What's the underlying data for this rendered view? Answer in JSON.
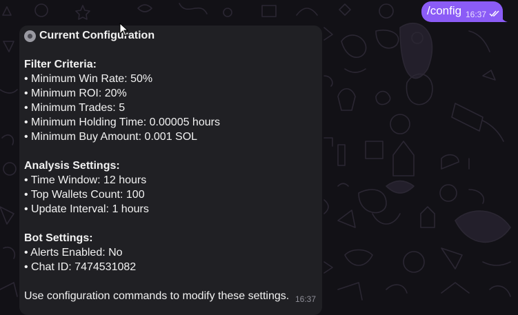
{
  "outgoing_message": {
    "text": "/config",
    "time": "16:37",
    "status": "read",
    "bubble_color": "#8b5cf6"
  },
  "incoming_message": {
    "header_icon": "gear-icon",
    "header": "Current Configuration",
    "sections": [
      {
        "title": "Filter Criteria:",
        "items": [
          "• Minimum Win Rate: 50%",
          "• Minimum ROI: 20%",
          "• Minimum Trades: 5",
          "• Minimum Holding Time: 0.00005 hours",
          "• Minimum Buy Amount: 0.001 SOL"
        ]
      },
      {
        "title": "Analysis Settings:",
        "items": [
          "• Time Window: 12 hours",
          "• Top Wallets Count: 100",
          "• Update Interval: 1 hours"
        ]
      },
      {
        "title": "Bot Settings:",
        "items": [
          "• Alerts Enabled: No",
          "• Chat ID: 7474531082"
        ]
      }
    ],
    "footer": "Use configuration commands to modify these settings.",
    "time": "16:37",
    "bubble_color": "#202024"
  },
  "background_color": "#121116"
}
